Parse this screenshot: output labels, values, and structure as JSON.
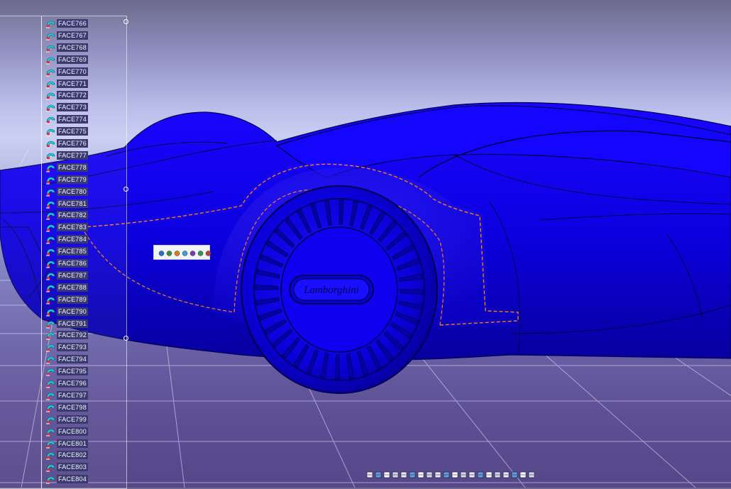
{
  "tree": {
    "items": [
      {
        "label": "FACE766"
      },
      {
        "label": "FACE767"
      },
      {
        "label": "FACE768"
      },
      {
        "label": "FACE769"
      },
      {
        "label": "FACE770"
      },
      {
        "label": "FACE771"
      },
      {
        "label": "FACE772"
      },
      {
        "label": "FACE773"
      },
      {
        "label": "FACE774"
      },
      {
        "label": "FACE775"
      },
      {
        "label": "FACE776"
      },
      {
        "label": "FACE777"
      },
      {
        "label": "FACE778"
      },
      {
        "label": "FACE779"
      },
      {
        "label": "FACE780"
      },
      {
        "label": "FACE781"
      },
      {
        "label": "FACE782"
      },
      {
        "label": "FACE783"
      },
      {
        "label": "FACE784"
      },
      {
        "label": "FACE785"
      },
      {
        "label": "FACE786"
      },
      {
        "label": "FACE787"
      },
      {
        "label": "FACE788"
      },
      {
        "label": "FACE789"
      },
      {
        "label": "FACE790"
      },
      {
        "label": "FACE791"
      },
      {
        "label": "FACE792"
      },
      {
        "label": "FACE793"
      },
      {
        "label": "FACE794"
      },
      {
        "label": "FACE795"
      },
      {
        "label": "FACE796"
      },
      {
        "label": "FACE797"
      },
      {
        "label": "FACE798"
      },
      {
        "label": "FACE799"
      },
      {
        "label": "FACE800"
      },
      {
        "label": "FACE801"
      },
      {
        "label": "FACE802"
      },
      {
        "label": "FACE803"
      },
      {
        "label": "FACE804"
      }
    ],
    "icon": "face-surface-icon"
  },
  "model": {
    "body_color": "#0d00e6",
    "edge_highlight_color": "#ff7a1a",
    "badge_text": "Lamborghini"
  },
  "mini_toolbar": {
    "icons": [
      "fly-mode-icon",
      "rotate-icon",
      "pan-icon",
      "zoom-in-icon",
      "zoom-out-icon",
      "normal-view-icon",
      "multi-view-icon"
    ]
  },
  "bottom_toolbar": {
    "icons": [
      "select-icon",
      "edit-icon",
      "fx-formula-icon",
      "chat-icon",
      "cube-icon",
      "gear-icon",
      "fit-all-icon",
      "pan-icon",
      "rotate-icon",
      "zoom-in-icon",
      "zoom-out-icon",
      "normal-view-icon",
      "iso-view-icon",
      "view-mode-icon",
      "shading-icon",
      "hide-show-icon",
      "swap-visible-icon",
      "lock-icon",
      "grid-icon",
      "sketcher-icon"
    ]
  }
}
